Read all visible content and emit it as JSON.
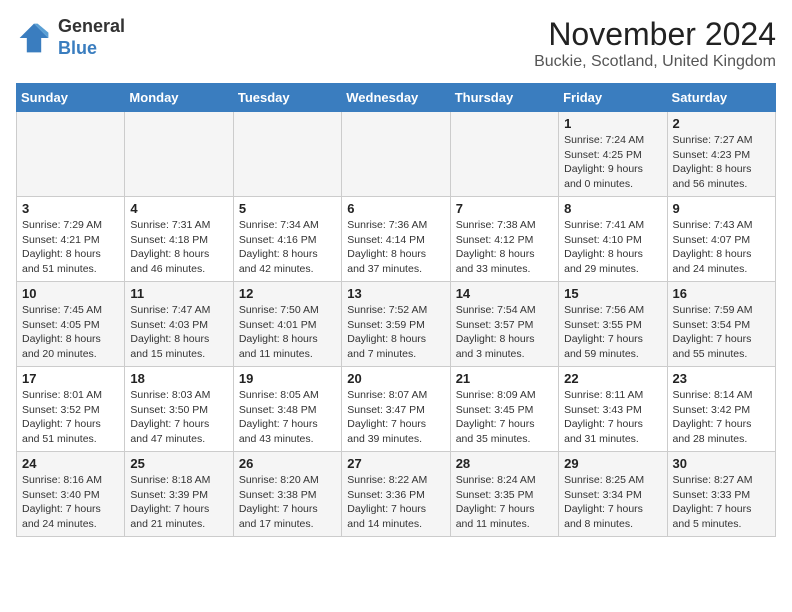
{
  "header": {
    "logo_line1": "General",
    "logo_line2": "Blue",
    "month_title": "November 2024",
    "location": "Buckie, Scotland, United Kingdom"
  },
  "days_of_week": [
    "Sunday",
    "Monday",
    "Tuesday",
    "Wednesday",
    "Thursday",
    "Friday",
    "Saturday"
  ],
  "weeks": [
    [
      {
        "day": "",
        "info": ""
      },
      {
        "day": "",
        "info": ""
      },
      {
        "day": "",
        "info": ""
      },
      {
        "day": "",
        "info": ""
      },
      {
        "day": "",
        "info": ""
      },
      {
        "day": "1",
        "info": "Sunrise: 7:24 AM\nSunset: 4:25 PM\nDaylight: 9 hours\nand 0 minutes."
      },
      {
        "day": "2",
        "info": "Sunrise: 7:27 AM\nSunset: 4:23 PM\nDaylight: 8 hours\nand 56 minutes."
      }
    ],
    [
      {
        "day": "3",
        "info": "Sunrise: 7:29 AM\nSunset: 4:21 PM\nDaylight: 8 hours\nand 51 minutes."
      },
      {
        "day": "4",
        "info": "Sunrise: 7:31 AM\nSunset: 4:18 PM\nDaylight: 8 hours\nand 46 minutes."
      },
      {
        "day": "5",
        "info": "Sunrise: 7:34 AM\nSunset: 4:16 PM\nDaylight: 8 hours\nand 42 minutes."
      },
      {
        "day": "6",
        "info": "Sunrise: 7:36 AM\nSunset: 4:14 PM\nDaylight: 8 hours\nand 37 minutes."
      },
      {
        "day": "7",
        "info": "Sunrise: 7:38 AM\nSunset: 4:12 PM\nDaylight: 8 hours\nand 33 minutes."
      },
      {
        "day": "8",
        "info": "Sunrise: 7:41 AM\nSunset: 4:10 PM\nDaylight: 8 hours\nand 29 minutes."
      },
      {
        "day": "9",
        "info": "Sunrise: 7:43 AM\nSunset: 4:07 PM\nDaylight: 8 hours\nand 24 minutes."
      }
    ],
    [
      {
        "day": "10",
        "info": "Sunrise: 7:45 AM\nSunset: 4:05 PM\nDaylight: 8 hours\nand 20 minutes."
      },
      {
        "day": "11",
        "info": "Sunrise: 7:47 AM\nSunset: 4:03 PM\nDaylight: 8 hours\nand 15 minutes."
      },
      {
        "day": "12",
        "info": "Sunrise: 7:50 AM\nSunset: 4:01 PM\nDaylight: 8 hours\nand 11 minutes."
      },
      {
        "day": "13",
        "info": "Sunrise: 7:52 AM\nSunset: 3:59 PM\nDaylight: 8 hours\nand 7 minutes."
      },
      {
        "day": "14",
        "info": "Sunrise: 7:54 AM\nSunset: 3:57 PM\nDaylight: 8 hours\nand 3 minutes."
      },
      {
        "day": "15",
        "info": "Sunrise: 7:56 AM\nSunset: 3:55 PM\nDaylight: 7 hours\nand 59 minutes."
      },
      {
        "day": "16",
        "info": "Sunrise: 7:59 AM\nSunset: 3:54 PM\nDaylight: 7 hours\nand 55 minutes."
      }
    ],
    [
      {
        "day": "17",
        "info": "Sunrise: 8:01 AM\nSunset: 3:52 PM\nDaylight: 7 hours\nand 51 minutes."
      },
      {
        "day": "18",
        "info": "Sunrise: 8:03 AM\nSunset: 3:50 PM\nDaylight: 7 hours\nand 47 minutes."
      },
      {
        "day": "19",
        "info": "Sunrise: 8:05 AM\nSunset: 3:48 PM\nDaylight: 7 hours\nand 43 minutes."
      },
      {
        "day": "20",
        "info": "Sunrise: 8:07 AM\nSunset: 3:47 PM\nDaylight: 7 hours\nand 39 minutes."
      },
      {
        "day": "21",
        "info": "Sunrise: 8:09 AM\nSunset: 3:45 PM\nDaylight: 7 hours\nand 35 minutes."
      },
      {
        "day": "22",
        "info": "Sunrise: 8:11 AM\nSunset: 3:43 PM\nDaylight: 7 hours\nand 31 minutes."
      },
      {
        "day": "23",
        "info": "Sunrise: 8:14 AM\nSunset: 3:42 PM\nDaylight: 7 hours\nand 28 minutes."
      }
    ],
    [
      {
        "day": "24",
        "info": "Sunrise: 8:16 AM\nSunset: 3:40 PM\nDaylight: 7 hours\nand 24 minutes."
      },
      {
        "day": "25",
        "info": "Sunrise: 8:18 AM\nSunset: 3:39 PM\nDaylight: 7 hours\nand 21 minutes."
      },
      {
        "day": "26",
        "info": "Sunrise: 8:20 AM\nSunset: 3:38 PM\nDaylight: 7 hours\nand 17 minutes."
      },
      {
        "day": "27",
        "info": "Sunrise: 8:22 AM\nSunset: 3:36 PM\nDaylight: 7 hours\nand 14 minutes."
      },
      {
        "day": "28",
        "info": "Sunrise: 8:24 AM\nSunset: 3:35 PM\nDaylight: 7 hours\nand 11 minutes."
      },
      {
        "day": "29",
        "info": "Sunrise: 8:25 AM\nSunset: 3:34 PM\nDaylight: 7 hours\nand 8 minutes."
      },
      {
        "day": "30",
        "info": "Sunrise: 8:27 AM\nSunset: 3:33 PM\nDaylight: 7 hours\nand 5 minutes."
      }
    ]
  ]
}
